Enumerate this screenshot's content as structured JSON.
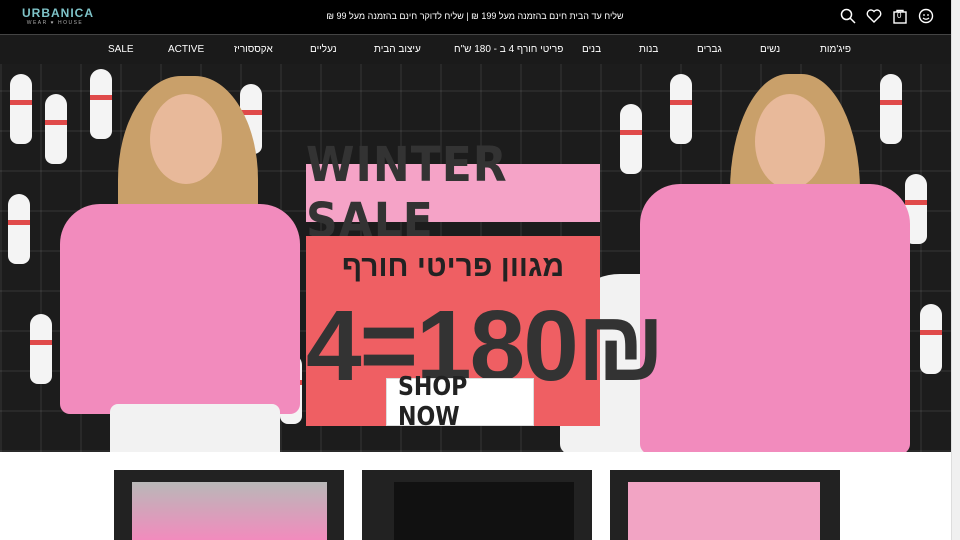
{
  "header": {
    "logo_text": "URBANICA",
    "logo_sub": "WEAR ♥ HOUSE",
    "announcement": "שליח עד הבית חינם בהזמנה מעל 199 ₪ | שליח לדוקר חינם בהזמנה מעל 99 ₪",
    "cart_count": "0",
    "icons": [
      "search-icon",
      "heart-icon",
      "cart-icon",
      "account-icon"
    ]
  },
  "nav": {
    "items": [
      {
        "label": "פיג'מות"
      },
      {
        "label": "נשים"
      },
      {
        "label": "גברים"
      },
      {
        "label": "בנות"
      },
      {
        "label": "בנים"
      },
      {
        "label": "פריטי חורף 4 ב - 180 ש\"ח"
      },
      {
        "label": "עיצוב הבית"
      },
      {
        "label": "נעליים"
      },
      {
        "label": "אקססוריז"
      },
      {
        "label": "ACTIVE"
      },
      {
        "label": "SALE"
      }
    ]
  },
  "hero": {
    "title": "WINTER SALE",
    "subtitle": "מגוון פריטי חורף",
    "price": "4=180₪",
    "cta": "SHOP NOW"
  },
  "colors": {
    "brand": "#7ec3c8",
    "sale_pink": "#f5a3c7",
    "sale_red": "#ef5f63",
    "hoodie": "#f28bbd"
  }
}
